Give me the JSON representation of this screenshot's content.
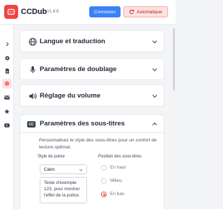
{
  "header": {
    "app_name": "CCDub",
    "version": "V1.8.6",
    "login_label": "Connexion",
    "auto_label": "Automatique"
  },
  "sidebar": {
    "items": [
      {
        "icon": "chevron-right-icon"
      },
      {
        "icon": "record-icon"
      },
      {
        "icon": "document-icon"
      },
      {
        "icon": "gear-icon",
        "active": true
      },
      {
        "icon": "mail-icon"
      },
      {
        "icon": "star-icon"
      },
      {
        "icon": "video-icon"
      }
    ]
  },
  "sections": [
    {
      "title": "Langue et traduction",
      "icon": "globe-icon"
    },
    {
      "title": "Paramètres de doublage",
      "icon": "microphone-icon"
    },
    {
      "title": "Réglage du volume",
      "icon": "volume-icon"
    }
  ],
  "subtitles": {
    "badge": "CC",
    "title": "Paramètres des sous-titres",
    "description": "Personnalisez le style des sous-titres pour un confort de lecture optimal.",
    "font_label": "Style de police",
    "font_value": "Cairo",
    "preview_text": "Texte d'exemple 123, pour montrer l'effet de la police.",
    "position_label": "Position des sous-titres",
    "positions": [
      {
        "label": "En haut",
        "checked": false
      },
      {
        "label": "Milieu",
        "checked": false
      },
      {
        "label": "En bas",
        "checked": true
      }
    ]
  },
  "colors": {
    "accent": "#ef4444",
    "primary": "#3b82f6"
  }
}
